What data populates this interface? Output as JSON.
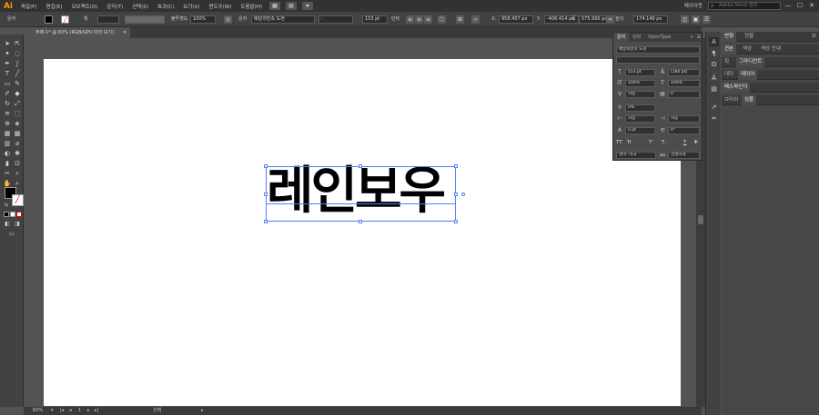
{
  "app": {
    "logo": "Ai",
    "menus": [
      "파일(F)",
      "편집(E)",
      "오브젝트(O)",
      "문자(T)",
      "선택(S)",
      "효과(C)",
      "보기(V)",
      "윈도우(W)",
      "도움말(H)"
    ],
    "workspace": "레이아웃",
    "search_placeholder": "Adobe Stock 검색",
    "win_min": "—",
    "win_max": "☐",
    "win_close": "✕"
  },
  "control": {
    "mode_label": "문자",
    "stroke_label": "획",
    "opacity_label": "불투명도",
    "opacity_value": "100%",
    "char_label": "문자",
    "font_name": "배달의민족 도현",
    "font_style": "-",
    "font_size": "153 pt",
    "para_label": "단락",
    "x_value": "958.407 px",
    "y_value": "-406.414 px",
    "width_label": "폭",
    "width_value": "575.995 px",
    "height_label": "높이",
    "height_value": "174.149 px"
  },
  "document": {
    "tab_title": "무제-1* @ 83% (RGB/GPU 미리 보기)",
    "tab_close": "✕",
    "text": "레인보우"
  },
  "status": {
    "zoom": "83%",
    "artboard_num": "1",
    "tool_name": "선택"
  },
  "char_panel": {
    "tabs": [
      "문자",
      "단락",
      "OpenType"
    ],
    "font_name": "배달의민족 도현",
    "font_style": "-",
    "size": "153 pt",
    "leading": "(180 pt)",
    "vscale": "100%",
    "hscale": "100%",
    "kerning": "자동",
    "tracking": "0",
    "tsume": "0%",
    "aki_left": "자동",
    "aki_right": "자동",
    "baseline": "0 pt",
    "rotation": "0°",
    "language": "영어: 미국",
    "aa": "선명하게",
    "glyph_caps": "TT",
    "glyph_small": "Tr",
    "glyph_super": "T'",
    "glyph_sub": "T,",
    "glyph_under": "T",
    "glyph_strike": "T"
  },
  "right_panel": {
    "row1_tabs": [
      "변형",
      "정렬"
    ],
    "row2_tabs": [
      "견본",
      "색상",
      "색상 안내"
    ],
    "row3_tabs": [
      "획",
      "그라디언트"
    ],
    "row4_tabs": [
      "대지",
      "레이어"
    ],
    "row5_tabs": [
      "패스파인더"
    ],
    "row6_tabs": [
      "브러쉬",
      "심볼"
    ]
  },
  "colors": {
    "accent": "#4f7ff2",
    "logo": "#ff9a00"
  }
}
